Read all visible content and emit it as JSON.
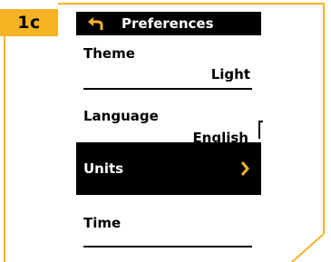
{
  "step": {
    "badge": "1c"
  },
  "header": {
    "title": "Preferences",
    "back_icon": "back-arrow-icon"
  },
  "menu": {
    "items": [
      {
        "label": "Theme",
        "value": "Light"
      },
      {
        "label": "Language",
        "value": "English"
      },
      {
        "label": "Units",
        "selected": true,
        "icon": "chevron-right-icon"
      },
      {
        "label": "Time",
        "value": ""
      }
    ]
  },
  "colors": {
    "accent": "#F5B324",
    "bar": "#000000",
    "text_on_dark": "#FFFFFF"
  }
}
